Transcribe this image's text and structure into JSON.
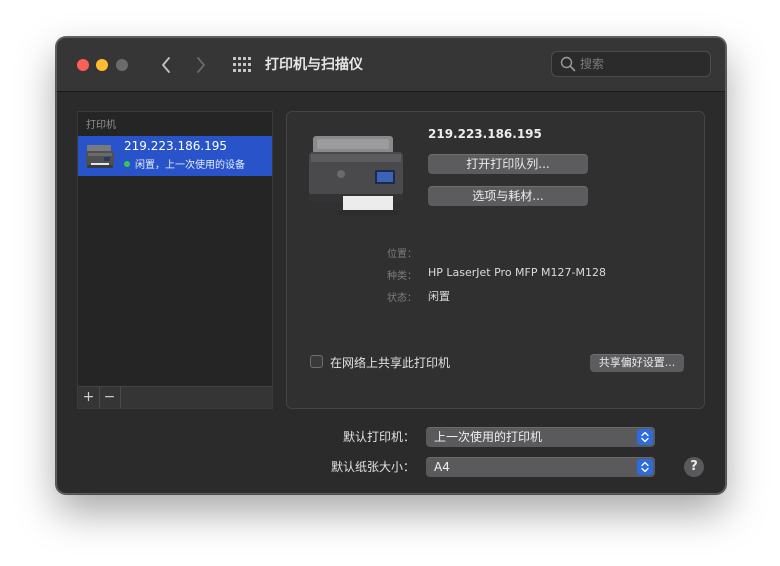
{
  "window": {
    "title": "打印机与扫描仪",
    "search_placeholder": "搜索"
  },
  "sidebar": {
    "header": "打印机",
    "printers": [
      {
        "name": "219.223.186.195",
        "status": "闲置，上一次使用的设备"
      }
    ],
    "add_label": "+",
    "remove_label": "−"
  },
  "detail": {
    "printer_name": "219.223.186.195",
    "open_queue_label": "打开打印队列...",
    "options_label": "选项与耗材...",
    "location_label": "位置：",
    "location_value": "",
    "kind_label": "种类：",
    "kind_value": "HP LaserJet Pro MFP M127-M128",
    "status_label": "状态：",
    "status_value": "闲置",
    "share_label": "在网络上共享此打印机",
    "share_checked": false,
    "share_prefs_label": "共享偏好设置..."
  },
  "defaults": {
    "default_printer_label": "默认打印机：",
    "default_printer_value": "上一次使用的打印机",
    "default_paper_label": "默认纸张大小：",
    "default_paper_value": "A4"
  },
  "help_label": "?",
  "colors": {
    "selection": "#2853c9",
    "close": "#fe5f57",
    "minimize": "#febc2e",
    "status_idle": "#3ac553",
    "popup_accent": "#2d6be0"
  }
}
